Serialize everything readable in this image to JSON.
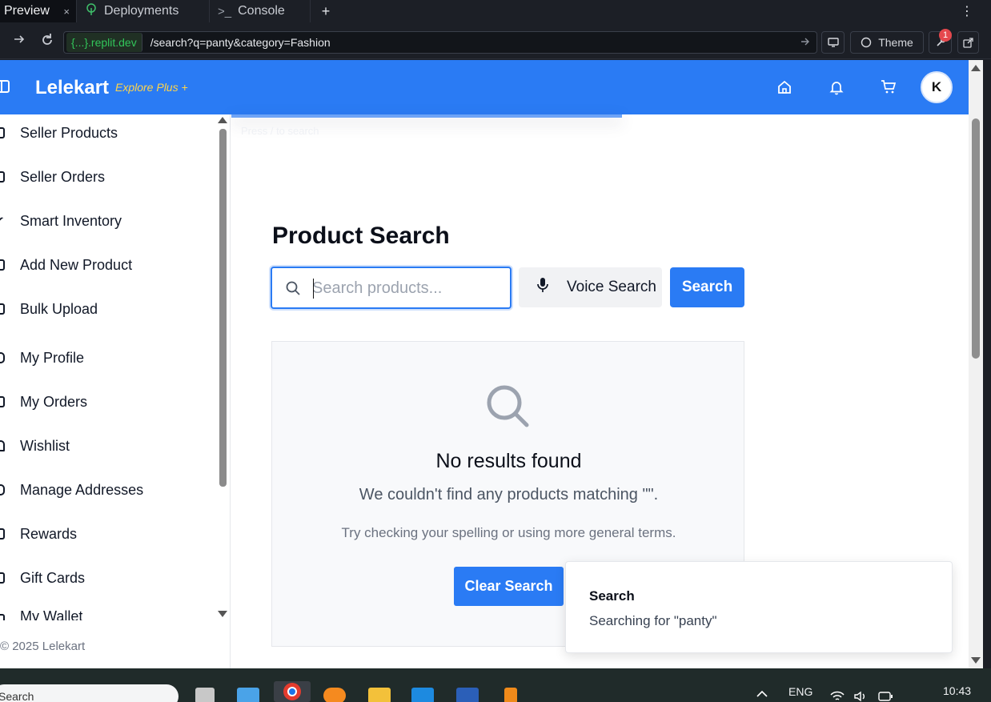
{
  "browser": {
    "tabs": [
      {
        "label": "Preview",
        "close": "×"
      },
      {
        "label": "Deployments"
      },
      {
        "label": "Console",
        "prefix": ">_"
      }
    ],
    "new_tab": "+",
    "menu": "⋮",
    "url_host": "{...}.replit.dev",
    "url_path": "/search?q=panty&category=Fashion",
    "theme_label": "Theme",
    "notification_count": "1"
  },
  "header": {
    "logo": "Lelekart",
    "tagline": "Explore Plus +",
    "avatar_initial": "K"
  },
  "sidebar": {
    "items": [
      {
        "label": "Seller Products"
      },
      {
        "label": "Seller Orders"
      },
      {
        "label": "Smart Inventory"
      },
      {
        "label": "Add New Product"
      },
      {
        "label": "Bulk Upload"
      },
      {
        "label": "My Profile"
      },
      {
        "label": "My Orders"
      },
      {
        "label": "Wishlist"
      },
      {
        "label": "Manage Addresses"
      },
      {
        "label": "Rewards"
      },
      {
        "label": "Gift Cards"
      },
      {
        "label": "My Wallet"
      }
    ],
    "copyright": "© 2025 Lelekart"
  },
  "main": {
    "ghost_text": "Press / to search",
    "title": "Product Search",
    "search_placeholder": "Search products...",
    "voice_label": "Voice Search",
    "search_label": "Search",
    "empty": {
      "title": "No results found",
      "message": "We couldn't find any products matching \"\".",
      "hint": "Try checking your spelling or using more general terms.",
      "clear_label": "Clear Search"
    }
  },
  "toast": {
    "title": "Search",
    "description": "Searching for \"panty\""
  },
  "taskbar": {
    "search_text": "Search",
    "language": "ENG",
    "time": "10:43"
  },
  "colors": {
    "brand": "#2a7bf4",
    "tagline": "#ffd44a"
  }
}
